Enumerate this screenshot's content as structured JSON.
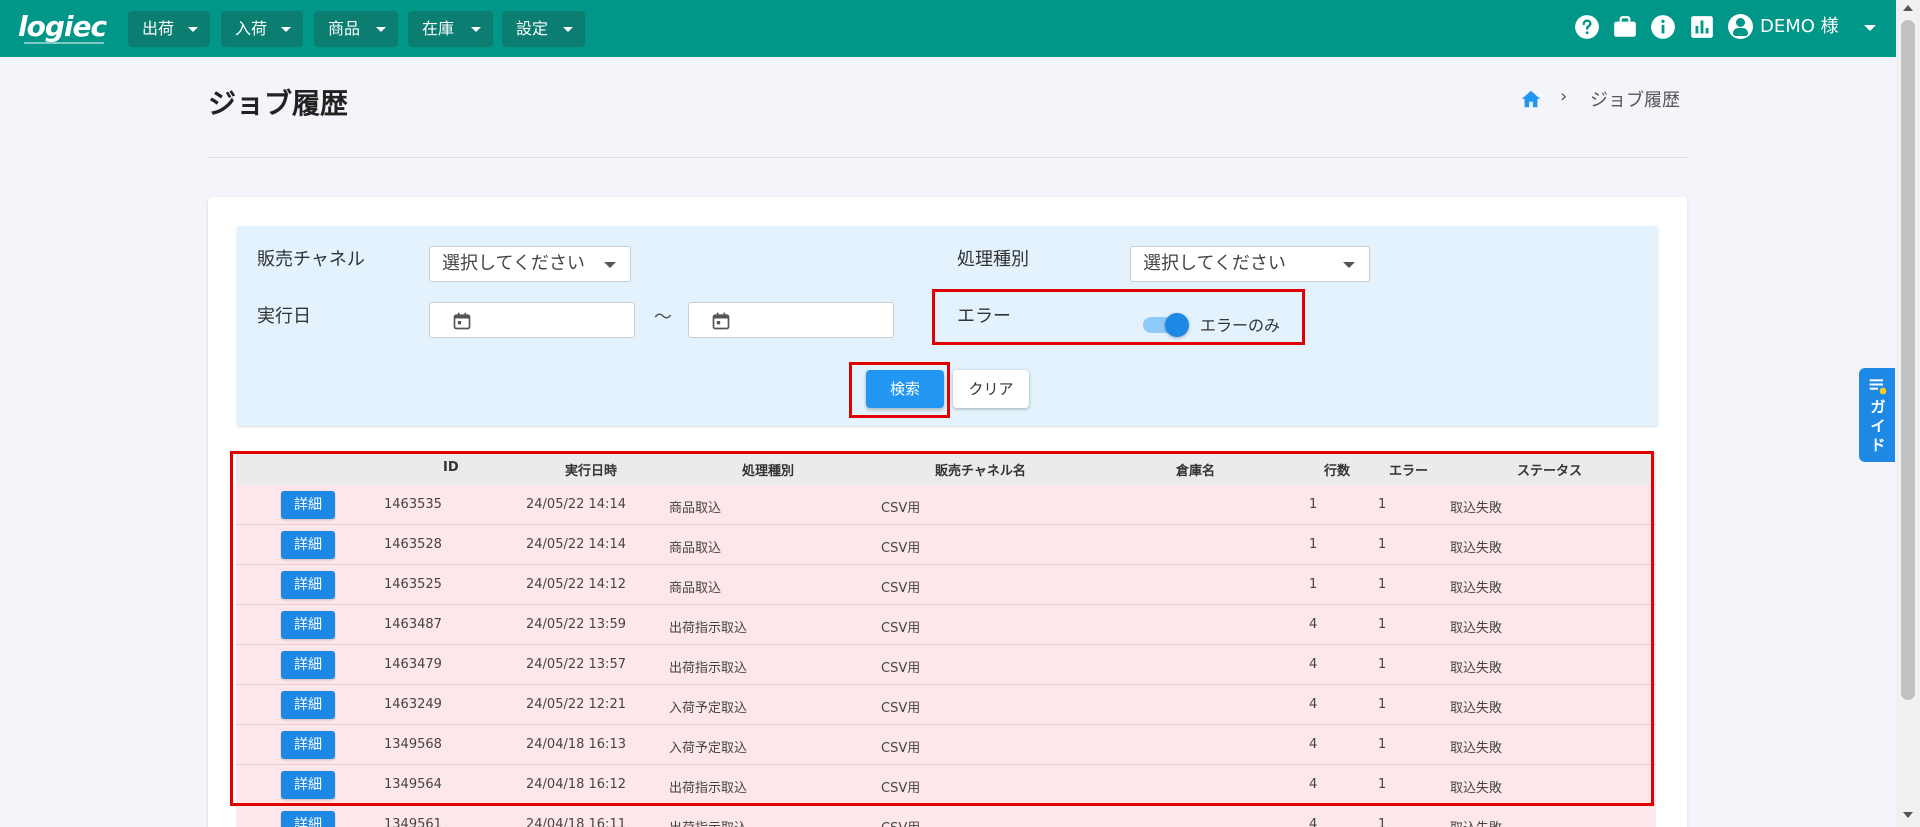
{
  "topbar": {
    "logo": "logiec",
    "nav": [
      "出荷",
      "入荷",
      "商品",
      "在庫",
      "設定"
    ],
    "icons": [
      "help-circle-icon",
      "briefcase-icon",
      "info-icon",
      "bar-chart-icon"
    ],
    "user_name": "DEMO 様",
    "color": "#009688"
  },
  "page": {
    "title": "ジョブ履歴",
    "breadcrumb_current": "ジョブ履歴"
  },
  "filter": {
    "channel_label": "販売チャネル",
    "channel_placeholder": "選択してください",
    "type_label": "処理種別",
    "type_placeholder": "選択してください",
    "date_label": "実行日",
    "date_sep": "〜",
    "error_label": "エラー",
    "error_toggle_label": "エラーのみ",
    "error_only": true,
    "search_button": "検索",
    "clear_button": "クリア"
  },
  "table": {
    "headers": [
      "ID",
      "実行日時",
      "処理種別",
      "販売チャネル名",
      "倉庫名",
      "行数",
      "エラー",
      "ステータス"
    ],
    "detail_label": "詳細",
    "rows": [
      {
        "id": "1463535",
        "datetime": "24/05/22 14:14",
        "type": "商品取込",
        "channel": "CSV用",
        "warehouse": "",
        "lines": "1",
        "errors": "1",
        "status": "取込失敗"
      },
      {
        "id": "1463528",
        "datetime": "24/05/22 14:14",
        "type": "商品取込",
        "channel": "CSV用",
        "warehouse": "",
        "lines": "1",
        "errors": "1",
        "status": "取込失敗"
      },
      {
        "id": "1463525",
        "datetime": "24/05/22 14:12",
        "type": "商品取込",
        "channel": "CSV用",
        "warehouse": "",
        "lines": "1",
        "errors": "1",
        "status": "取込失敗"
      },
      {
        "id": "1463487",
        "datetime": "24/05/22 13:59",
        "type": "出荷指示取込",
        "channel": "CSV用",
        "warehouse": "",
        "lines": "4",
        "errors": "1",
        "status": "取込失敗"
      },
      {
        "id": "1463479",
        "datetime": "24/05/22 13:57",
        "type": "出荷指示取込",
        "channel": "CSV用",
        "warehouse": "",
        "lines": "4",
        "errors": "1",
        "status": "取込失敗"
      },
      {
        "id": "1463249",
        "datetime": "24/05/22 12:21",
        "type": "入荷予定取込",
        "channel": "CSV用",
        "warehouse": "",
        "lines": "4",
        "errors": "1",
        "status": "取込失敗"
      },
      {
        "id": "1349568",
        "datetime": "24/04/18 16:13",
        "type": "入荷予定取込",
        "channel": "CSV用",
        "warehouse": "",
        "lines": "4",
        "errors": "1",
        "status": "取込失敗"
      },
      {
        "id": "1349564",
        "datetime": "24/04/18 16:12",
        "type": "出荷指示取込",
        "channel": "CSV用",
        "warehouse": "",
        "lines": "4",
        "errors": "1",
        "status": "取込失敗"
      },
      {
        "id": "1349561",
        "datetime": "24/04/18 16:11",
        "type": "出荷指示取込",
        "channel": "CSV用",
        "warehouse": "",
        "lines": "4",
        "errors": "1",
        "status": "取込失敗"
      }
    ]
  },
  "guide": {
    "label": "ガイド"
  }
}
